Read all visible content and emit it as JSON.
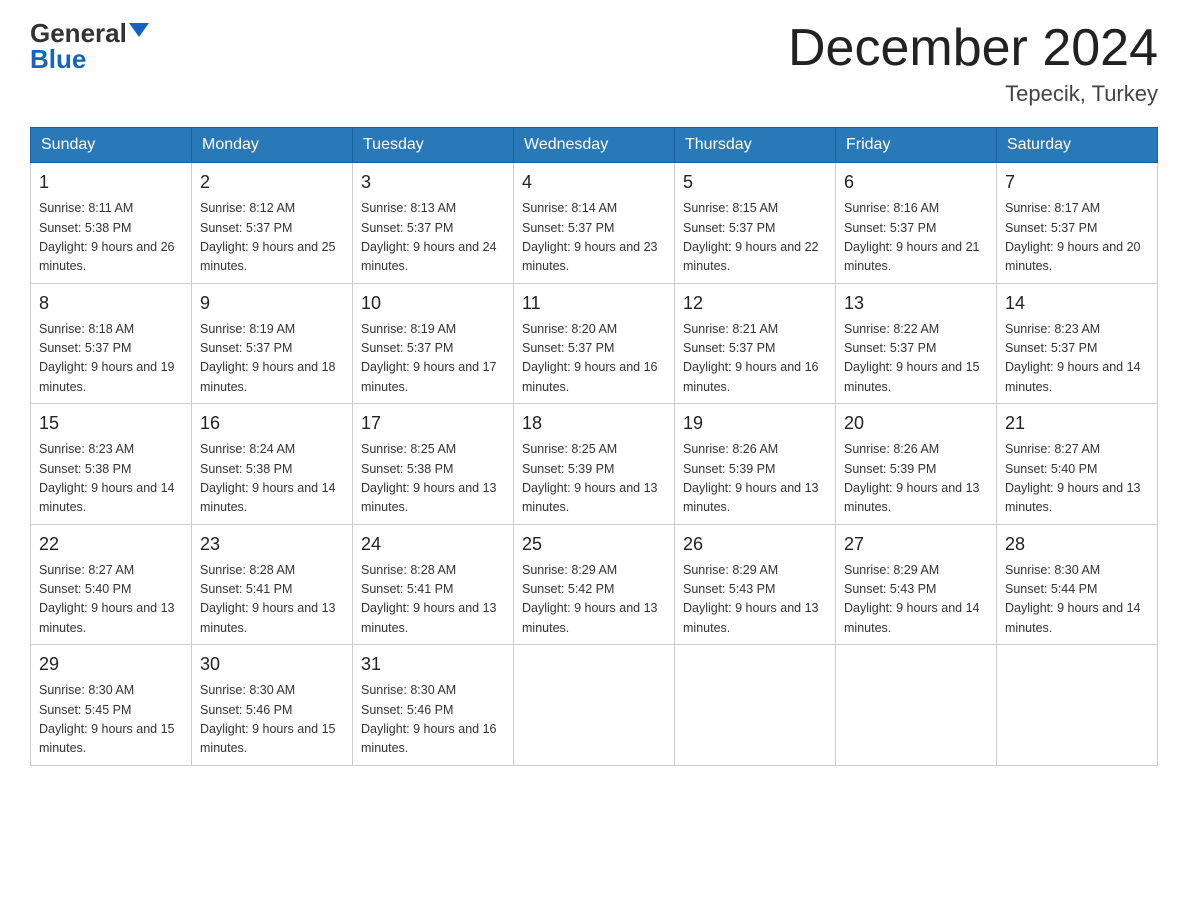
{
  "header": {
    "logo_line1": "General",
    "logo_line2": "Blue",
    "month_title": "December 2024",
    "location": "Tepecik, Turkey"
  },
  "days_of_week": [
    "Sunday",
    "Monday",
    "Tuesday",
    "Wednesday",
    "Thursday",
    "Friday",
    "Saturday"
  ],
  "weeks": [
    [
      {
        "day": "1",
        "sunrise": "8:11 AM",
        "sunset": "5:38 PM",
        "daylight": "9 hours and 26 minutes."
      },
      {
        "day": "2",
        "sunrise": "8:12 AM",
        "sunset": "5:37 PM",
        "daylight": "9 hours and 25 minutes."
      },
      {
        "day": "3",
        "sunrise": "8:13 AM",
        "sunset": "5:37 PM",
        "daylight": "9 hours and 24 minutes."
      },
      {
        "day": "4",
        "sunrise": "8:14 AM",
        "sunset": "5:37 PM",
        "daylight": "9 hours and 23 minutes."
      },
      {
        "day": "5",
        "sunrise": "8:15 AM",
        "sunset": "5:37 PM",
        "daylight": "9 hours and 22 minutes."
      },
      {
        "day": "6",
        "sunrise": "8:16 AM",
        "sunset": "5:37 PM",
        "daylight": "9 hours and 21 minutes."
      },
      {
        "day": "7",
        "sunrise": "8:17 AM",
        "sunset": "5:37 PM",
        "daylight": "9 hours and 20 minutes."
      }
    ],
    [
      {
        "day": "8",
        "sunrise": "8:18 AM",
        "sunset": "5:37 PM",
        "daylight": "9 hours and 19 minutes."
      },
      {
        "day": "9",
        "sunrise": "8:19 AM",
        "sunset": "5:37 PM",
        "daylight": "9 hours and 18 minutes."
      },
      {
        "day": "10",
        "sunrise": "8:19 AM",
        "sunset": "5:37 PM",
        "daylight": "9 hours and 17 minutes."
      },
      {
        "day": "11",
        "sunrise": "8:20 AM",
        "sunset": "5:37 PM",
        "daylight": "9 hours and 16 minutes."
      },
      {
        "day": "12",
        "sunrise": "8:21 AM",
        "sunset": "5:37 PM",
        "daylight": "9 hours and 16 minutes."
      },
      {
        "day": "13",
        "sunrise": "8:22 AM",
        "sunset": "5:37 PM",
        "daylight": "9 hours and 15 minutes."
      },
      {
        "day": "14",
        "sunrise": "8:23 AM",
        "sunset": "5:37 PM",
        "daylight": "9 hours and 14 minutes."
      }
    ],
    [
      {
        "day": "15",
        "sunrise": "8:23 AM",
        "sunset": "5:38 PM",
        "daylight": "9 hours and 14 minutes."
      },
      {
        "day": "16",
        "sunrise": "8:24 AM",
        "sunset": "5:38 PM",
        "daylight": "9 hours and 14 minutes."
      },
      {
        "day": "17",
        "sunrise": "8:25 AM",
        "sunset": "5:38 PM",
        "daylight": "9 hours and 13 minutes."
      },
      {
        "day": "18",
        "sunrise": "8:25 AM",
        "sunset": "5:39 PM",
        "daylight": "9 hours and 13 minutes."
      },
      {
        "day": "19",
        "sunrise": "8:26 AM",
        "sunset": "5:39 PM",
        "daylight": "9 hours and 13 minutes."
      },
      {
        "day": "20",
        "sunrise": "8:26 AM",
        "sunset": "5:39 PM",
        "daylight": "9 hours and 13 minutes."
      },
      {
        "day": "21",
        "sunrise": "8:27 AM",
        "sunset": "5:40 PM",
        "daylight": "9 hours and 13 minutes."
      }
    ],
    [
      {
        "day": "22",
        "sunrise": "8:27 AM",
        "sunset": "5:40 PM",
        "daylight": "9 hours and 13 minutes."
      },
      {
        "day": "23",
        "sunrise": "8:28 AM",
        "sunset": "5:41 PM",
        "daylight": "9 hours and 13 minutes."
      },
      {
        "day": "24",
        "sunrise": "8:28 AM",
        "sunset": "5:41 PM",
        "daylight": "9 hours and 13 minutes."
      },
      {
        "day": "25",
        "sunrise": "8:29 AM",
        "sunset": "5:42 PM",
        "daylight": "9 hours and 13 minutes."
      },
      {
        "day": "26",
        "sunrise": "8:29 AM",
        "sunset": "5:43 PM",
        "daylight": "9 hours and 13 minutes."
      },
      {
        "day": "27",
        "sunrise": "8:29 AM",
        "sunset": "5:43 PM",
        "daylight": "9 hours and 14 minutes."
      },
      {
        "day": "28",
        "sunrise": "8:30 AM",
        "sunset": "5:44 PM",
        "daylight": "9 hours and 14 minutes."
      }
    ],
    [
      {
        "day": "29",
        "sunrise": "8:30 AM",
        "sunset": "5:45 PM",
        "daylight": "9 hours and 15 minutes."
      },
      {
        "day": "30",
        "sunrise": "8:30 AM",
        "sunset": "5:46 PM",
        "daylight": "9 hours and 15 minutes."
      },
      {
        "day": "31",
        "sunrise": "8:30 AM",
        "sunset": "5:46 PM",
        "daylight": "9 hours and 16 minutes."
      },
      null,
      null,
      null,
      null
    ]
  ]
}
